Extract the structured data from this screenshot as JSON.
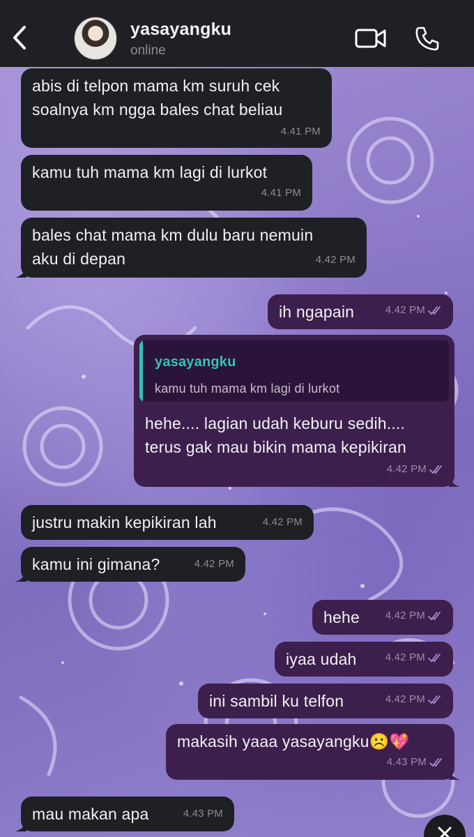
{
  "header": {
    "contact_name": "yasayangku",
    "status": "online"
  },
  "colors": {
    "header_bg": "#1f1f24",
    "incoming_bubble": "#1e2024",
    "outgoing_bubble": "#3d1f4d",
    "quote_accent": "#33c0b6",
    "read_ticks": "#b48cd8"
  },
  "icons": {
    "back": "chevron-left-icon",
    "video": "video-camera-icon",
    "call": "phone-icon",
    "ticks": "double-check-icon",
    "close": "close-icon"
  },
  "messages": [
    {
      "dir": "in",
      "line1": "abis di telpon mama km suruh cek",
      "line2": "soalnya km ngga bales chat beliau",
      "time": "4.41 PM"
    },
    {
      "dir": "in",
      "text": "kamu tuh mama km lagi di lurkot",
      "time": "4.41 PM"
    },
    {
      "dir": "in",
      "line1": "bales chat mama km dulu baru nemuin",
      "line2": "aku di depan",
      "time": "4.42 PM"
    },
    {
      "dir": "out",
      "text": "ih ngapain",
      "time": "4.42 PM"
    },
    {
      "dir": "out",
      "reply": {
        "name": "yasayangku",
        "text": "kamu tuh mama km lagi di lurkot"
      },
      "line1": "hehe.... lagian udah keburu sedih....",
      "line2": "terus gak mau bikin mama kepikiran",
      "time": "4.42 PM"
    },
    {
      "dir": "in",
      "text": "justru makin kepikiran lah",
      "time": "4.42 PM"
    },
    {
      "dir": "in",
      "text": "kamu ini gimana?",
      "time": "4.42 PM"
    },
    {
      "dir": "out",
      "text": "hehe",
      "time": "4.42 PM"
    },
    {
      "dir": "out",
      "text": "iyaa udah",
      "time": "4.42 PM"
    },
    {
      "dir": "out",
      "text": "ini sambil ku telfon",
      "time": "4.42 PM"
    },
    {
      "dir": "out",
      "text": "makasih yaaa yasayangku☹️💖",
      "time": "4.43 PM"
    },
    {
      "dir": "in",
      "text": "mau makan apa",
      "time": "4.43 PM"
    }
  ]
}
